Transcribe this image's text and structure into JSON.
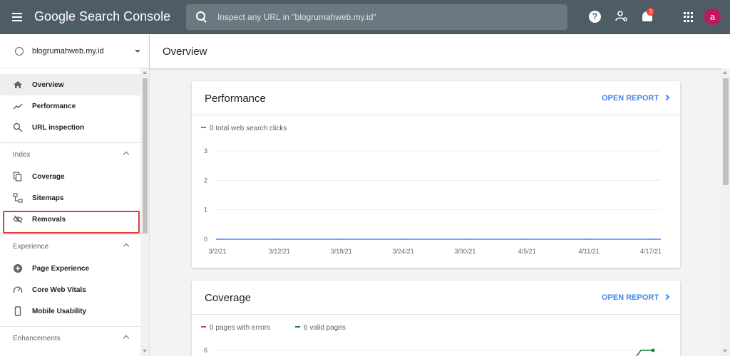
{
  "app": {
    "title": "Google Search Console",
    "search_placeholder": "Inspect any URL in \"blogrumahweb.my.id\"",
    "notification_count": "3",
    "avatar_letter": "a",
    "help_glyph": "?",
    "icons": [
      "menu-icon",
      "search-icon",
      "help-icon",
      "manage-users-icon",
      "bell-icon",
      "apps-grid-icon"
    ],
    "colors": {
      "topbar": "#4e5c66",
      "accent_blue": "#4285f4",
      "error_red": "#e53935",
      "valid_green": "#188038",
      "avatar": "#c2185b",
      "badge": "#e2463c"
    }
  },
  "sidebar": {
    "property": "blogrumahweb.my.id",
    "top_items": [
      {
        "label": "Overview",
        "icon": "home-icon",
        "active": true
      },
      {
        "label": "Performance",
        "icon": "trending-up-icon"
      },
      {
        "label": "URL inspection",
        "icon": "search-icon"
      }
    ],
    "sections": [
      {
        "title": "Index",
        "items": [
          {
            "label": "Coverage",
            "icon": "coverage-icon"
          },
          {
            "label": "Sitemaps",
            "icon": "sitemap-icon"
          },
          {
            "label": "Removals",
            "icon": "eye-off-icon",
            "highlighted": true
          }
        ]
      },
      {
        "title": "Experience",
        "items": [
          {
            "label": "Page Experience",
            "icon": "page-experience-icon"
          },
          {
            "label": "Core Web Vitals",
            "icon": "speedometer-icon"
          },
          {
            "label": "Mobile Usability",
            "icon": "phone-icon"
          }
        ]
      },
      {
        "title": "Enhancements",
        "items": []
      }
    ]
  },
  "main": {
    "title": "Overview",
    "performance": {
      "title": "Performance",
      "open_report": "OPEN REPORT",
      "legend": "0 total web search clicks"
    },
    "coverage": {
      "title": "Coverage",
      "open_report": "OPEN REPORT",
      "legend_errors": "0 pages with errors",
      "legend_valid": "6 valid pages"
    }
  },
  "chart_data": [
    {
      "type": "line",
      "title": "Performance",
      "x": [
        "3/2/21",
        "3/12/21",
        "3/18/21",
        "3/24/21",
        "3/30/21",
        "4/5/21",
        "4/11/21",
        "4/17/21"
      ],
      "series": [
        {
          "name": "0 total web search clicks",
          "color": "#4285f4",
          "values": [
            0,
            0,
            0,
            0,
            0,
            0,
            0,
            0
          ]
        }
      ],
      "yticks": [
        0,
        1,
        2,
        3
      ],
      "ylim": [
        0,
        3
      ],
      "grid": true
    },
    {
      "type": "line",
      "title": "Coverage",
      "series": [
        {
          "name": "0 pages with errors",
          "color": "#e53935"
        },
        {
          "name": "6 valid pages",
          "color": "#188038",
          "last_value": 6
        }
      ],
      "yticks": [
        6
      ],
      "grid": true
    }
  ]
}
